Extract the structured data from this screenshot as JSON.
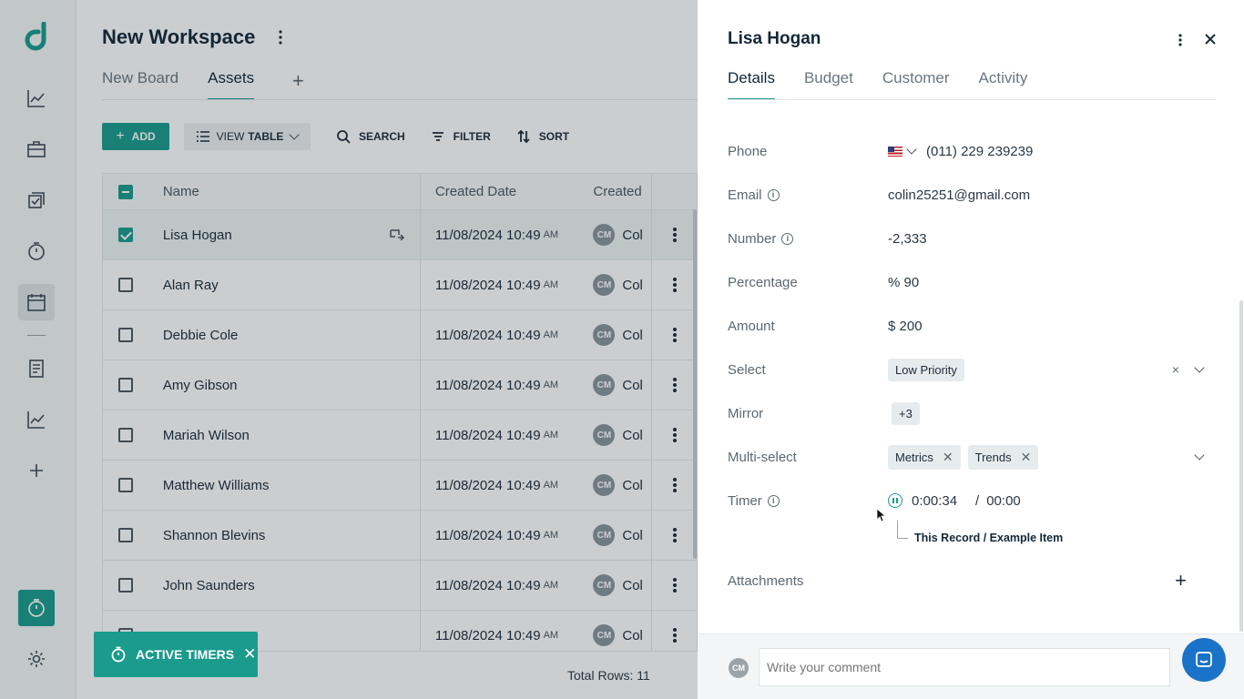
{
  "workspace": {
    "title": "New Workspace",
    "tabs": [
      "New Board",
      "Assets"
    ],
    "active_tab": 1
  },
  "toolbar": {
    "add": "ADD",
    "view_prefix": "VIEW",
    "view_bold": "TABLE",
    "search": "SEARCH",
    "filter": "FILTER",
    "sort": "SORT"
  },
  "table": {
    "columns": [
      "Name",
      "Created Date",
      "Created"
    ],
    "rows": [
      {
        "name": "Lisa Hogan",
        "date": "11/08/2024 10:49",
        "ampm": "AM",
        "avatar": "CM",
        "by": "Col",
        "checked": true
      },
      {
        "name": "Alan Ray",
        "date": "11/08/2024 10:49",
        "ampm": "AM",
        "avatar": "CM",
        "by": "Col",
        "checked": false
      },
      {
        "name": "Debbie Cole",
        "date": "11/08/2024 10:49",
        "ampm": "AM",
        "avatar": "CM",
        "by": "Col",
        "checked": false
      },
      {
        "name": "Amy Gibson",
        "date": "11/08/2024 10:49",
        "ampm": "AM",
        "avatar": "CM",
        "by": "Col",
        "checked": false
      },
      {
        "name": "Mariah Wilson",
        "date": "11/08/2024 10:49",
        "ampm": "AM",
        "avatar": "CM",
        "by": "Col",
        "checked": false
      },
      {
        "name": "Matthew Williams",
        "date": "11/08/2024 10:49",
        "ampm": "AM",
        "avatar": "CM",
        "by": "Col",
        "checked": false
      },
      {
        "name": "Shannon Blevins",
        "date": "11/08/2024 10:49",
        "ampm": "AM",
        "avatar": "CM",
        "by": "Col",
        "checked": false
      },
      {
        "name": "John Saunders",
        "date": "11/08/2024 10:49",
        "ampm": "AM",
        "avatar": "CM",
        "by": "Col",
        "checked": false
      },
      {
        "name": "",
        "date": "11/08/2024 10:49",
        "ampm": "AM",
        "avatar": "CM",
        "by": "Col",
        "checked": false
      }
    ],
    "total_rows": "Total Rows: 11"
  },
  "active_timers": "ACTIVE TIMERS",
  "panel": {
    "title": "Lisa Hogan",
    "tabs": [
      "Details",
      "Budget",
      "Customer",
      "Activity"
    ],
    "fields": {
      "phone_label": "Phone",
      "phone": "(011) 229 239239",
      "email_label": "Email",
      "email": "colin25251@gmail.com",
      "number_label": "Number",
      "number": "-2,333",
      "percentage_label": "Percentage",
      "percentage": "% 90",
      "amount_label": "Amount",
      "amount": "$ 200",
      "select_label": "Select",
      "select": "Low Priority",
      "mirror_label": "Mirror",
      "mirror": "+3",
      "multiselect_label": "Multi-select",
      "multiselect": [
        "Metrics",
        "Trends"
      ],
      "timer_label": "Timer",
      "timer_elapsed": "0:00:34",
      "timer_sep": "/",
      "timer_total": "00:00",
      "timer_record": "This Record / Example Item",
      "attachments_label": "Attachments"
    },
    "comment_avatar": "CM",
    "comment_placeholder": "Write your comment"
  },
  "colors": {
    "accent": "#1a9b8c",
    "chat": "#1a73c8"
  }
}
